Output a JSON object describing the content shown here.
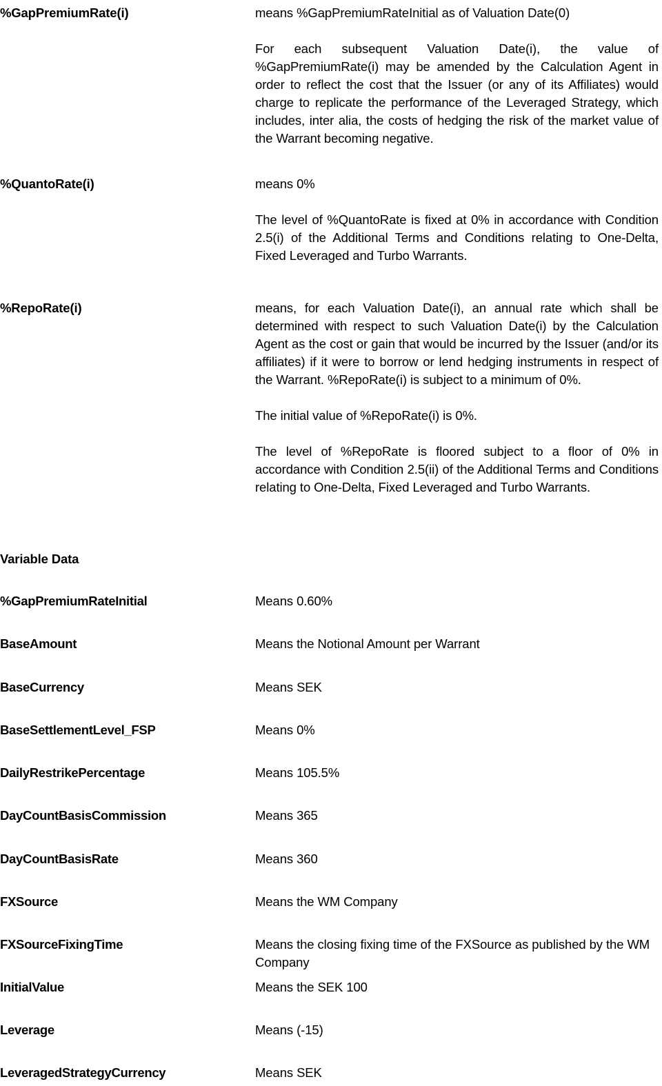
{
  "definitions": [
    {
      "term": "%GapPremiumRate(i)",
      "paragraphs": [
        "means %GapPremiumRateInitial as of Valuation Date(0)",
        "For each subsequent Valuation Date(i), the value of %GapPremiumRate(i) may be amended by the Calculation Agent in order to reflect the cost that the Issuer (or any of its Affiliates) would charge to replicate the performance of the Leveraged Strategy, which includes, inter alia, the costs of hedging the risk of the market value of the Warrant becoming negative."
      ]
    },
    {
      "term": "%QuantoRate(i)",
      "paragraphs": [
        "means 0%",
        "The level of %QuantoRate is fixed at 0% in accordance with Condition 2.5(i) of the Additional Terms and Conditions relating to One-Delta, Fixed Leveraged and Turbo Warrants."
      ]
    },
    {
      "term": "%RepoRate(i)",
      "paragraphs": [
        "means, for each Valuation Date(i), an annual rate which shall be determined with respect to such Valuation Date(i) by the Calculation Agent as the cost or gain that would be incurred by the Issuer (and/or its affiliates) if it were to borrow or lend hedging instruments in respect of the Warrant. %RepoRate(i) is subject to a minimum of 0%.",
        "The initial value of %RepoRate(i) is 0%.",
        "The level of %RepoRate is floored subject to a floor of 0% in accordance with Condition 2.5(ii) of the Additional Terms and Conditions relating to One-Delta, Fixed Leveraged and Turbo Warrants."
      ]
    }
  ],
  "variable_data": {
    "heading": "Variable Data",
    "rows": [
      {
        "key": "%GapPremiumRateInitial",
        "value": "Means 0.60%"
      },
      {
        "key": "BaseAmount",
        "value": "Means the Notional Amount per Warrant"
      },
      {
        "key": "BaseCurrency",
        "value": "Means SEK"
      },
      {
        "key": "BaseSettlementLevel_FSP",
        "value": "Means 0%"
      },
      {
        "key": "DailyRestrikePercentage",
        "value": "Means 105.5%"
      },
      {
        "key": "DayCountBasisCommission",
        "value": "Means 365"
      },
      {
        "key": "DayCountBasisRate",
        "value": "Means 360"
      },
      {
        "key": "FXSource",
        "value": "Means the WM Company"
      },
      {
        "key": "FXSourceFixingTime",
        "value": "Means the closing fixing time of the FXSource as published by the WM Company"
      },
      {
        "key": "InitialValue",
        "value": "Means the SEK 100"
      },
      {
        "key": "Leverage",
        "value": "Means (-15)"
      },
      {
        "key": "LeveragedStrategyCurrency",
        "value": "Means SEK"
      }
    ]
  }
}
